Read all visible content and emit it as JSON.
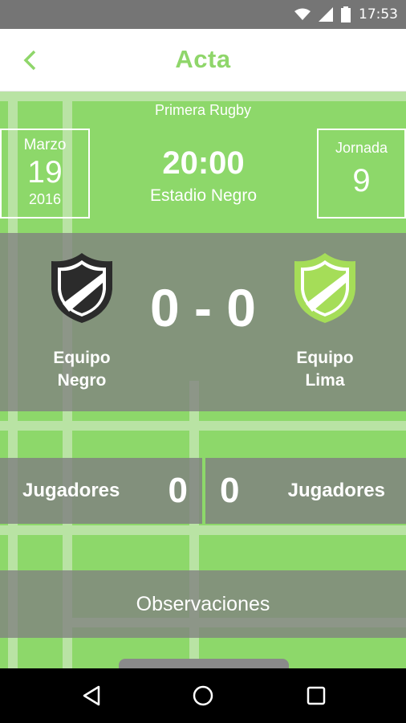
{
  "status_bar": {
    "time": "17:53",
    "icons": [
      "wifi-icon",
      "cell-signal-icon",
      "battery-icon"
    ]
  },
  "app_bar": {
    "title": "Acta",
    "back_icon": "chevron-left-icon",
    "accent_color": "#8fd66a"
  },
  "match": {
    "league": "Primera Rugby",
    "date": {
      "month": "Marzo",
      "day": "19",
      "year": "2016"
    },
    "time": "20:00",
    "venue": "Estadio Negro",
    "round": {
      "label": "Jornada",
      "number": "9"
    },
    "score": "0 - 0",
    "home_team": {
      "name_line1": "Equipo",
      "name_line2": "Negro",
      "shield_color": "#2b2b2b",
      "shield_icon": "shield-icon"
    },
    "away_team": {
      "name_line1": "Equipo",
      "name_line2": "Lima",
      "shield_color": "#a5dd58",
      "shield_icon": "shield-icon"
    }
  },
  "players": {
    "home": {
      "label": "Jugadores",
      "count": "0"
    },
    "away": {
      "label": "Jugadores",
      "count": "0"
    }
  },
  "observations": {
    "label": "Observaciones"
  },
  "nav_bar": {
    "icons": [
      "back-triangle-icon",
      "home-circle-icon",
      "recents-square-icon"
    ]
  }
}
